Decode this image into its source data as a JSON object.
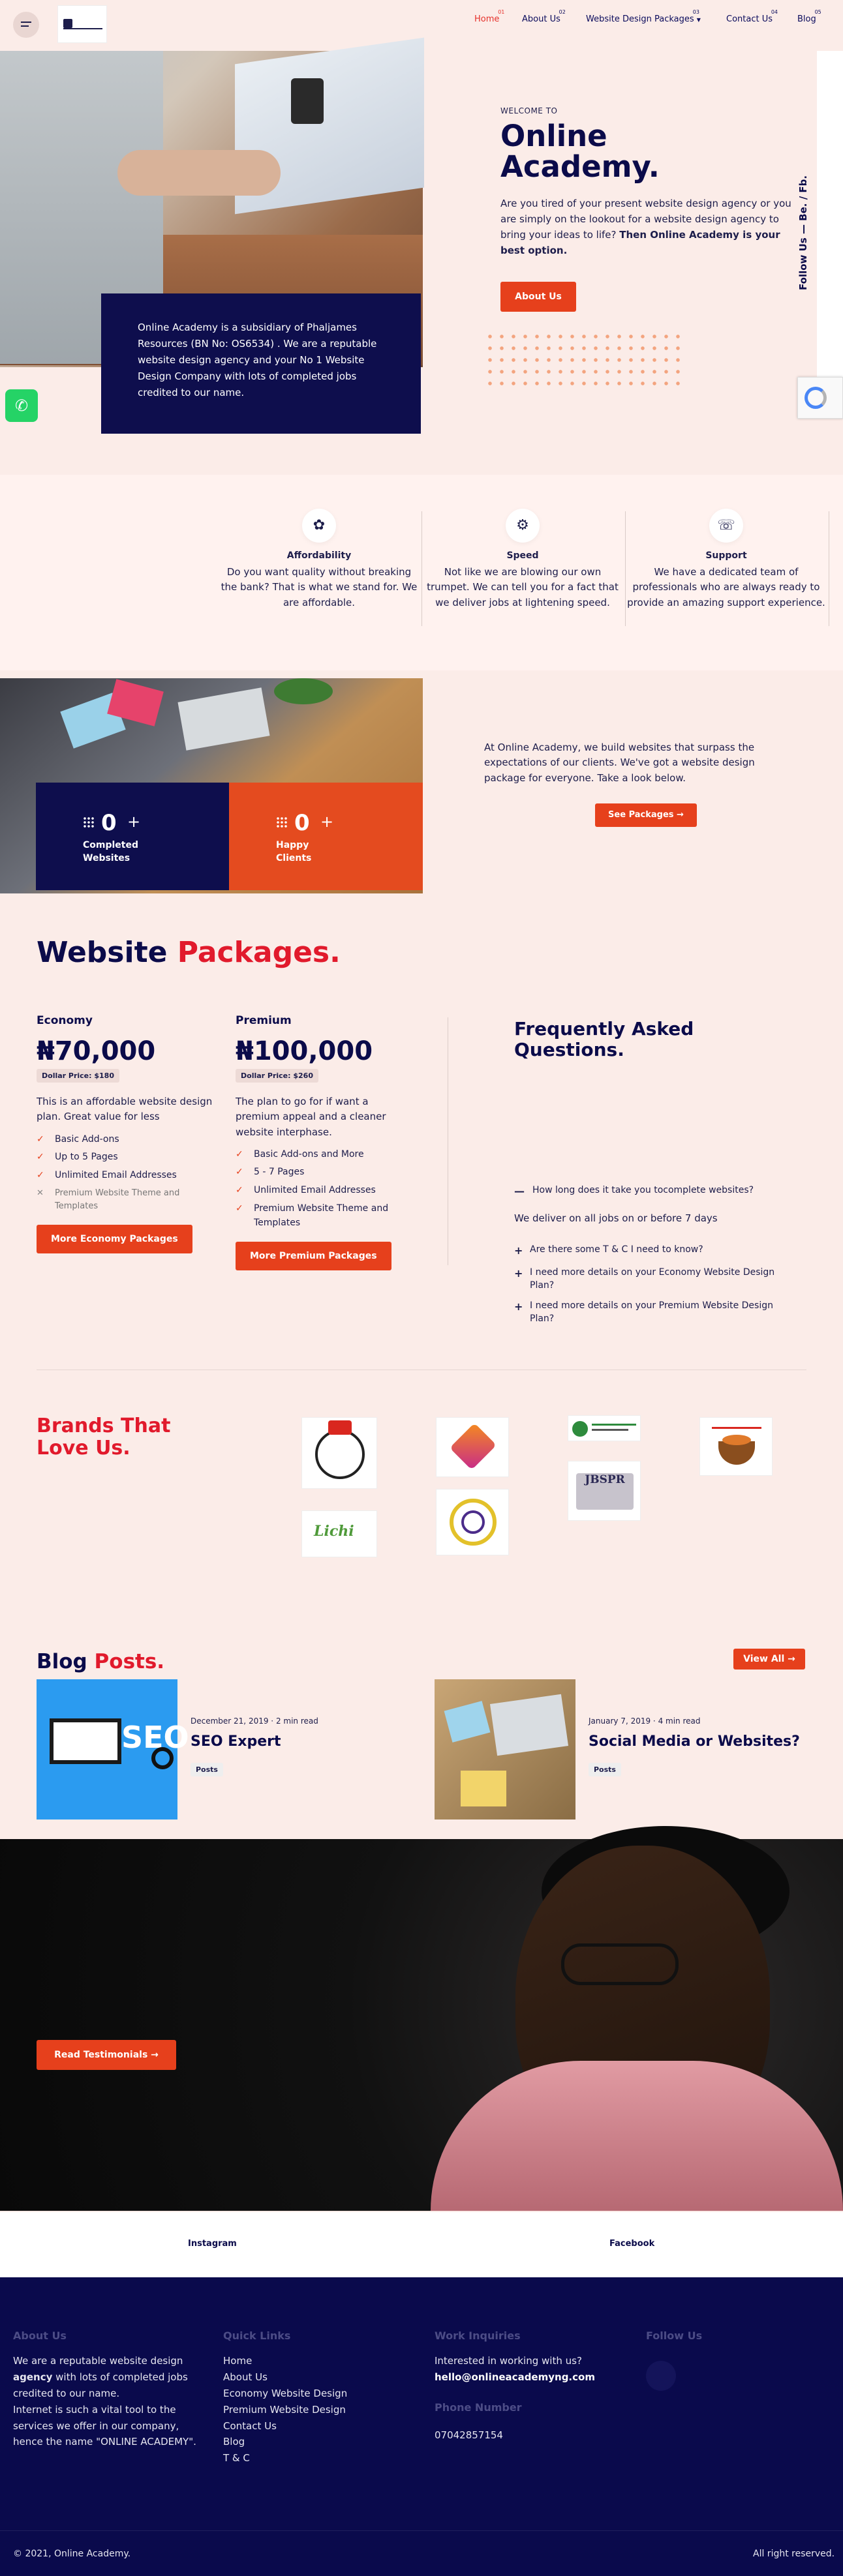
{
  "header": {
    "nav": [
      {
        "num": "01",
        "label": "Home",
        "active": true
      },
      {
        "num": "02",
        "label": "About Us"
      },
      {
        "num": "03",
        "label": "Website Design Packages"
      },
      {
        "num": "04",
        "label": "Contact Us"
      },
      {
        "num": "05",
        "label": "Blog"
      }
    ]
  },
  "hero": {
    "box_text": "Online Academy is a subsidiary of Phaljames Resources (BN No: OS6534) . We are a reputable website design agency  and your No 1 Website Design Company with lots of completed jobs credited to our name.",
    "welcome": "WELCOME TO",
    "title": "Online Academy.",
    "text_pre": "Are you tired of your present website design agency or you are simply on the lookout for a website design agency to bring your ideas to life?  ",
    "text_bold": "Then Online Academy is your best option.",
    "about_btn": "About Us",
    "follow": "Follow Us  —   Be.   /   Fb."
  },
  "features": [
    {
      "icon": "leaf-icon",
      "title": "Affordability",
      "text": "Do you want quality without breaking the bank? That is what we stand for. We are affordable."
    },
    {
      "icon": "speedometer-icon",
      "title": "Speed",
      "text": "Not like we are blowing our own trumpet. We can tell you for a fact that we deliver jobs at lightening speed."
    },
    {
      "icon": "headset-icon",
      "title": "Support",
      "text": "We have a dedicated team of professionals who are always ready to provide an amazing support experience."
    }
  ],
  "stats": {
    "items": [
      {
        "value": "0",
        "plus": "+",
        "label_line1": "Completed",
        "label_line2": "Websites"
      },
      {
        "value": "0",
        "plus": "+",
        "label_line1": "Happy",
        "label_line2": "Clients"
      }
    ],
    "text": "At Online Academy, we build websites that surpass the expectations of our clients. We've got a website design package for everyone. Take a look below.",
    "button": "See Packages"
  },
  "packages": {
    "title_part1": "Website",
    "title_part2": "Packages.",
    "items": [
      {
        "name": "Economy",
        "price": "₦70,000",
        "dollar": "Dollar Price: $180",
        "desc": "This is an affordable website design plan. Great value for less",
        "features": [
          "Basic Add-ons",
          "Up to 5 Pages",
          "Unlimited Email Addresses"
        ],
        "excluded": [
          "Premium Website Theme and Templates"
        ],
        "button": "More Economy Packages"
      },
      {
        "name": "Premium",
        "price": "₦100,000",
        "dollar": "Dollar Price: $260",
        "desc": "The plan to go for if want a premium appeal and a cleaner website interphase.",
        "features": [
          "Basic Add-ons and More",
          "5 - 7 Pages",
          "Unlimited Email Addresses",
          "Premium Website Theme and Templates"
        ],
        "excluded": [],
        "button": "More Premium Packages"
      }
    ]
  },
  "faq": {
    "title": "Frequently Asked Questions.",
    "open_q": "How long does it take you tocomplete websites?",
    "open_a": "We deliver on all jobs on or before 7 days",
    "items": [
      "Are there some T & C I need to know?",
      "I need more details on your Economy Website Design Plan?",
      "I need more details on your Premium Website Design Plan?"
    ]
  },
  "brands": {
    "title_line1": "Brands That",
    "title_line2": "Love Us.",
    "logos": [
      "brand-logo-globe",
      "brand-logo-e",
      "brand-logo-pharma",
      "brand-logo-bowl",
      "brand-logo-lichi",
      "brand-logo-seal",
      "brand-logo-jbspr"
    ],
    "jbspr_text": "JBSPR",
    "lichi_text": "Lichi"
  },
  "blog": {
    "title_part1": "Blog",
    "title_part2": "Posts.",
    "view_all": "View All",
    "posts": [
      {
        "date": "December 21, 2019",
        "read": "2 min read",
        "title": "SEO Expert",
        "tag": "Posts",
        "img_text": "SEO"
      },
      {
        "date": "January 7, 2019",
        "read": "4 min read",
        "title": "Social Media or Websites?",
        "tag": "Posts"
      }
    ]
  },
  "testimonials": {
    "button": "Read Testimonials"
  },
  "social": {
    "instagram": "Instagram",
    "facebook": "Facebook"
  },
  "footer": {
    "about": {
      "title": "About Us",
      "text1": "We are a reputable website design ",
      "bold": "agency",
      "text2": " with lots of completed jobs credited to our name.",
      "text3": "Internet is such a vital tool to the services we offer in our company, hence the name \"ONLINE ACADEMY\"."
    },
    "quick": {
      "title": "Quick Links",
      "links": [
        "Home",
        "About Us",
        "Economy Website Design",
        "Premium Website Design",
        "Contact Us",
        "Blog",
        "T & C"
      ]
    },
    "work": {
      "title": "Work Inquiries",
      "line": "Interested in working with us?",
      "email": "hello@onlineacademyng.com",
      "phone_title": "Phone Number",
      "phone": "07042857154"
    },
    "follow": {
      "title": "Follow Us"
    },
    "copyright": "© 2021, Online Academy.",
    "rights": "All right reserved."
  },
  "colors": {
    "accent": "#e6401c",
    "navy": "#0b0b4a",
    "red": "#e11a2c",
    "bg": "#fbece8"
  }
}
